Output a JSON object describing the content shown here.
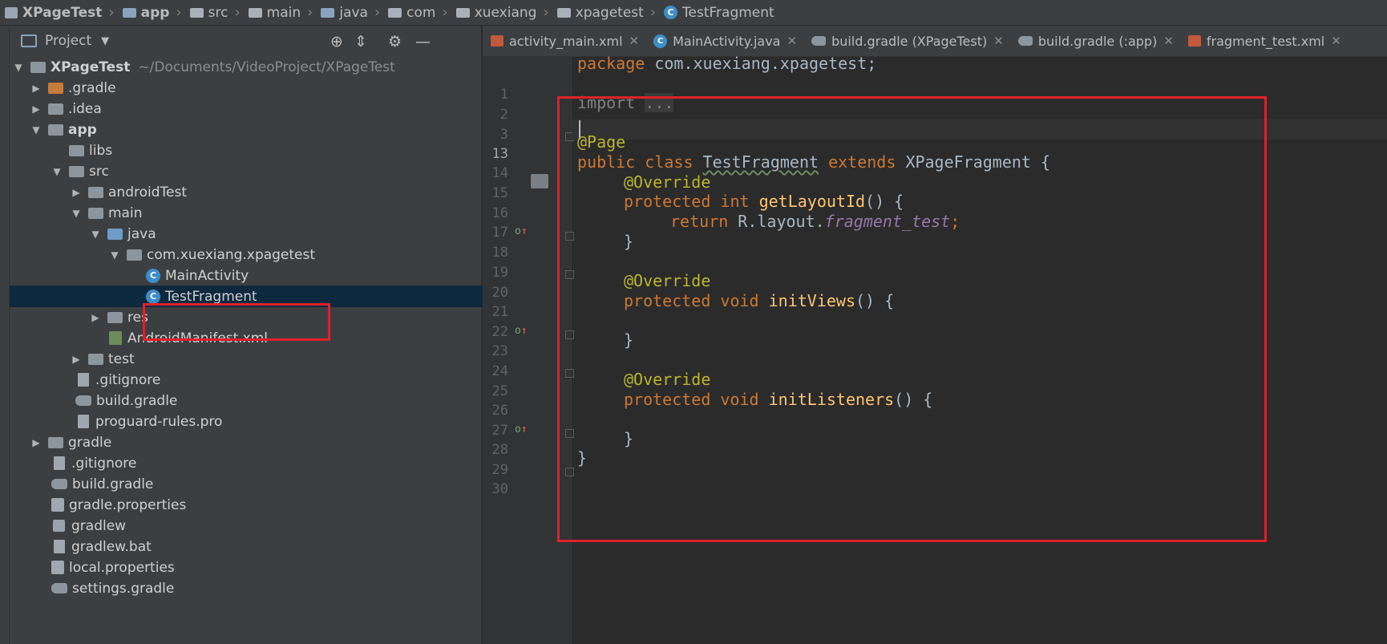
{
  "breadcrumb": [
    "XPageTest",
    "app",
    "src",
    "main",
    "java",
    "com",
    "xuexiang",
    "xpagetest",
    "TestFragment"
  ],
  "project_panel": {
    "title": "Project",
    "tree": [
      {
        "label": "XPageTest",
        "extra": "~/Documents/VideoProject/XPageTest"
      },
      {
        "label": ".gradle"
      },
      {
        "label": ".idea"
      },
      {
        "label": "app"
      },
      {
        "label": "libs"
      },
      {
        "label": "src"
      },
      {
        "label": "androidTest"
      },
      {
        "label": "main"
      },
      {
        "label": "java"
      },
      {
        "label": "com.xuexiang.xpagetest"
      },
      {
        "label": "MainActivity"
      },
      {
        "label": "TestFragment"
      },
      {
        "label": "res"
      },
      {
        "label": "AndroidManifest.xml"
      },
      {
        "label": "test"
      },
      {
        "label": ".gitignore"
      },
      {
        "label": "build.gradle"
      },
      {
        "label": "proguard-rules.pro"
      },
      {
        "label": "gradle"
      },
      {
        "label": ".gitignore"
      },
      {
        "label": "build.gradle"
      },
      {
        "label": "gradle.properties"
      },
      {
        "label": "gradlew"
      },
      {
        "label": "gradlew.bat"
      },
      {
        "label": "local.properties"
      },
      {
        "label": "settings.gradle"
      }
    ]
  },
  "tabs": [
    {
      "label": "activity_main.xml"
    },
    {
      "label": "MainActivity.java"
    },
    {
      "label": "build.gradle (XPageTest)"
    },
    {
      "label": "build.gradle (:app)"
    },
    {
      "label": "fragment_test.xml"
    }
  ],
  "code": {
    "line_numbers": [
      "1",
      "2",
      "3",
      "13",
      "14",
      "15",
      "16",
      "17",
      "18",
      "19",
      "20",
      "21",
      "22",
      "23",
      "24",
      "25",
      "26",
      "27",
      "28",
      "29",
      "30"
    ],
    "package_kw": "package",
    "package_name": "com.xuexiang.xpagetest;",
    "import_kw": "import",
    "import_fold": "...",
    "page_annotation": "@Page",
    "class_decl_kw": "public class",
    "class_name": "TestFragment",
    "extends_kw": "extends",
    "super_name": "XPageFragment {",
    "override": "@Override",
    "protected_int": "protected int",
    "get_layout": "getLayoutId",
    "parens_open": "() {",
    "return_kw": "return",
    "r_layout": "R.layout.",
    "fragment_test": "fragment_test",
    "semicolon": ";",
    "close_brace": "}",
    "protected_void": "protected void",
    "init_views": "initViews",
    "init_listeners": "initListeners"
  }
}
